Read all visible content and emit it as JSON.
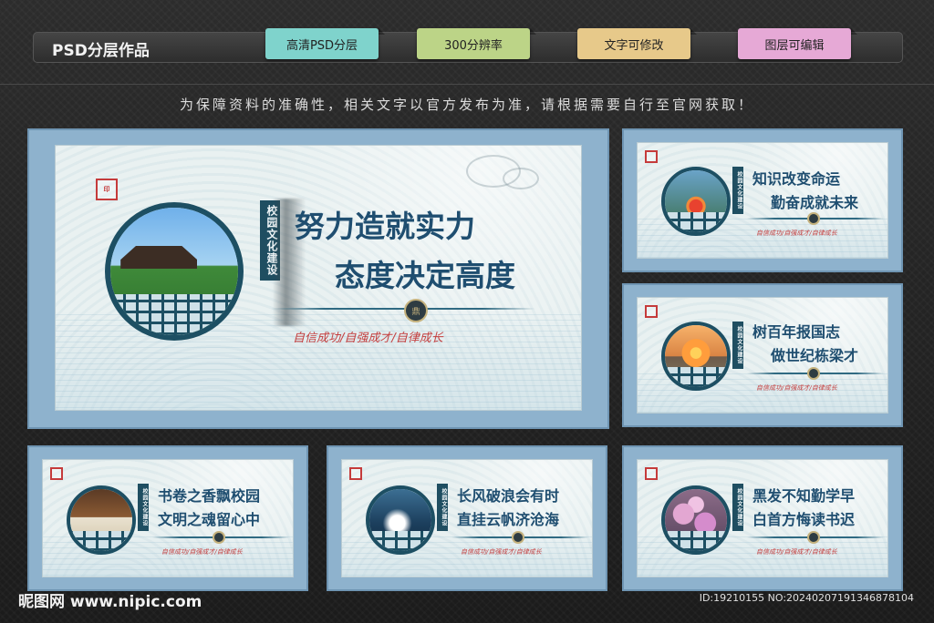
{
  "header": {
    "brand": "PSD分层作品",
    "tags": [
      {
        "label": "高清PSD分层",
        "color": "#7fd3cc"
      },
      {
        "label": "300分辨率",
        "color": "#bcd487"
      },
      {
        "label": "文字可修改",
        "color": "#e7c98a"
      },
      {
        "label": "图层可编辑",
        "color": "#e6a9d6"
      }
    ]
  },
  "notice": "为保障资料的准确性，相关文字以官方发布为准，请根据需要自行至官网获取！",
  "common": {
    "ribbon": "校园文化建设",
    "motto": "自信成功/自强成才/自律成长"
  },
  "cards": [
    {
      "line1": "努力造就实力",
      "line2": "态度决定高度",
      "photo": "building"
    },
    {
      "line1": "知识改变命运",
      "line2": "勤奋成就未来",
      "photo": "flower"
    },
    {
      "line1": "树百年报国志",
      "line2": "做世纪栋梁才",
      "photo": "sunset"
    },
    {
      "line1": "书卷之香飘校园",
      "line2": "文明之魂留心中",
      "photo": "book"
    },
    {
      "line1": "长风破浪会有时",
      "line2": "直挂云帆济沧海",
      "photo": "wave"
    },
    {
      "line1": "黑发不知勤学早",
      "line2": "白首方悔读书迟",
      "photo": "blossom"
    }
  ],
  "footer": {
    "site": "昵图网 www.nipic.com",
    "id": "ID:19210155 NO:20240207191346878104"
  },
  "colors": {
    "frame": "#8eb2cd",
    "title": "#1f4e70",
    "motto": "#c43e3e",
    "seal": "#c53b3b"
  }
}
